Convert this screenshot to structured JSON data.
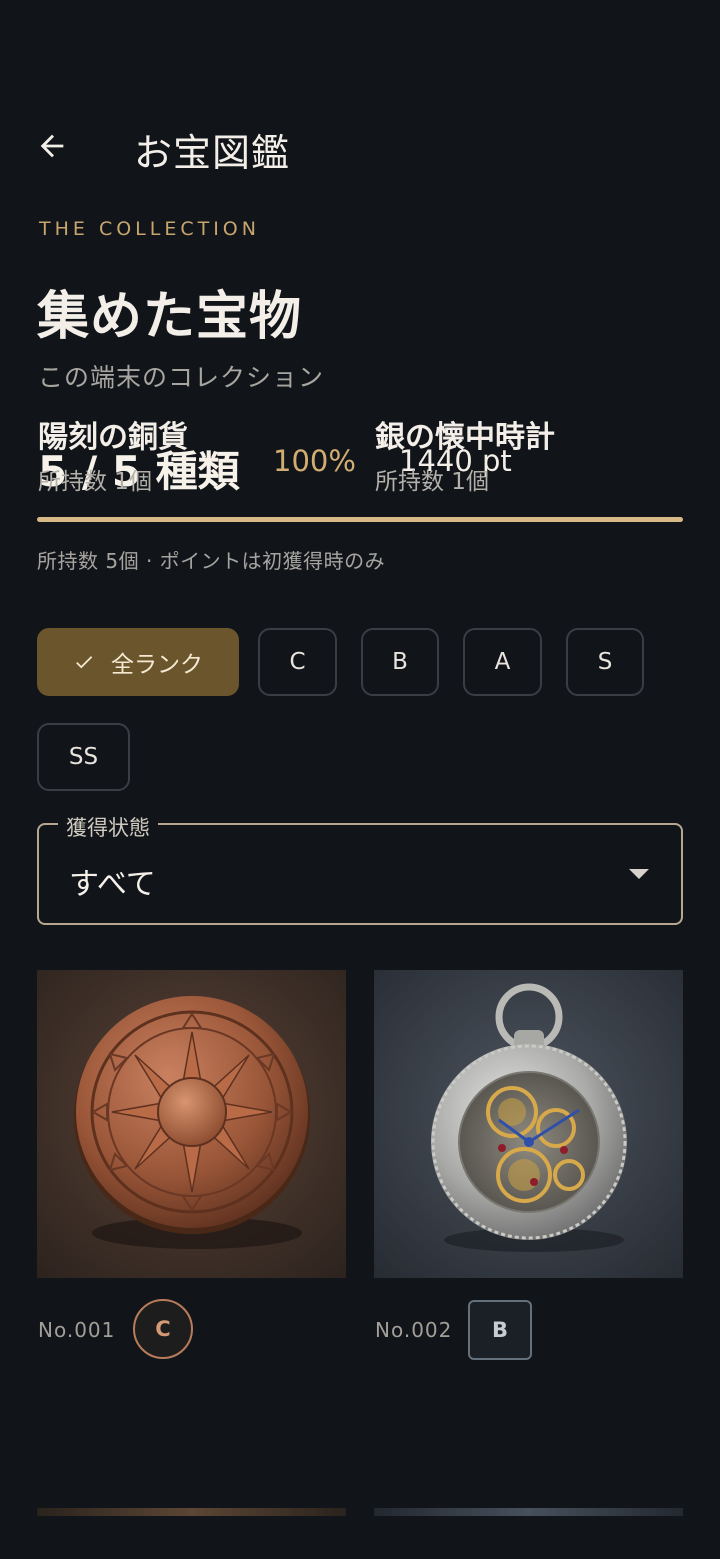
{
  "header": {
    "title": "お宝図鑑",
    "back_icon": "arrow-left-icon"
  },
  "eyebrow": "THE COLLECTION",
  "headline": "集めた宝物",
  "subtitle": "この端末のコレクション",
  "stats": {
    "count": "5 / 5 種類",
    "percent": "100%",
    "points": "1440 pt",
    "progress": 1.0
  },
  "note": "所持数 5個 · ポイントは初獲得時のみ",
  "rank_filters": [
    {
      "label": "全ランク",
      "selected": true
    },
    {
      "label": "C",
      "selected": false
    },
    {
      "label": "B",
      "selected": false
    },
    {
      "label": "A",
      "selected": false
    },
    {
      "label": "S",
      "selected": false
    },
    {
      "label": "SS",
      "selected": false
    }
  ],
  "status_select": {
    "label": "獲得状態",
    "value": "すべて"
  },
  "items": [
    {
      "number": "No.001",
      "rank": "C",
      "name": "陽刻の銅貨",
      "owned": "所持数 1個",
      "image": "copper-sun-coin"
    },
    {
      "number": "No.002",
      "rank": "B",
      "name": "銀の懐中時計",
      "owned": "所持数 1個",
      "image": "silver-pocket-watch"
    }
  ],
  "colors": {
    "background": "#11151a",
    "accent_gold": "#d1ad72",
    "active_chip": "#6b552d",
    "rank_c": "#b87c5a",
    "rank_b": "#64707c"
  }
}
